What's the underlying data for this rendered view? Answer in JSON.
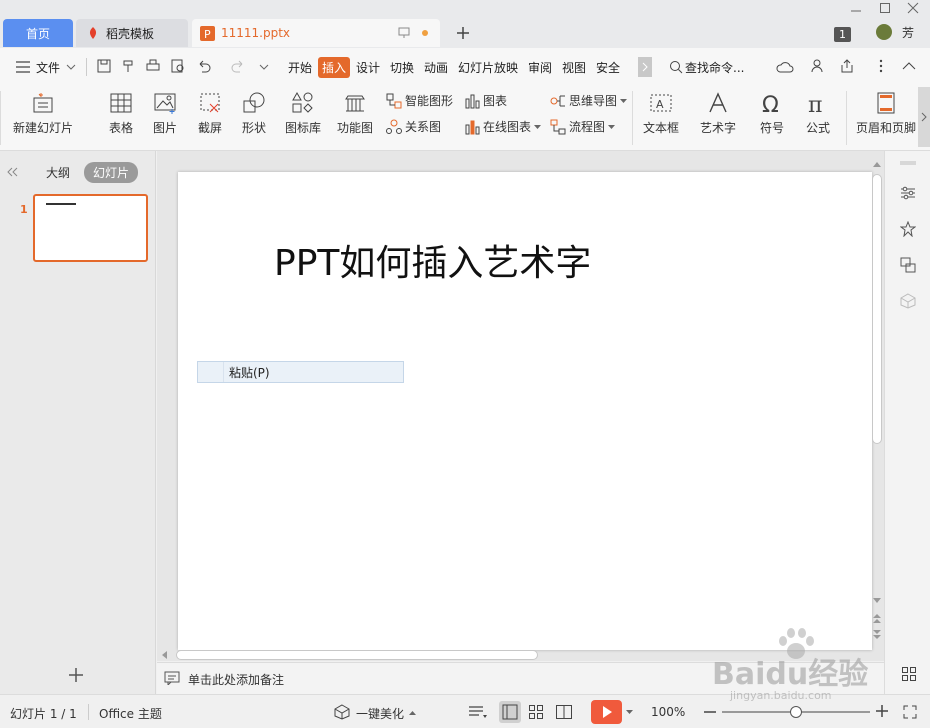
{
  "titlebar": {
    "tabs": [
      {
        "label": "首页"
      },
      {
        "label": "稻壳模板"
      },
      {
        "label": "11111.pptx"
      }
    ],
    "badge": "1",
    "user": "芳"
  },
  "menubar": {
    "file_label": "文件",
    "items": [
      "开始",
      "插入",
      "设计",
      "切换",
      "动画",
      "幻灯片放映",
      "审阅",
      "视图",
      "安全"
    ],
    "active": "插入",
    "search_placeholder": "查找命令..."
  },
  "ribbon": {
    "new_slide": "新建幻灯片",
    "table": "表格",
    "picture": "图片",
    "screenshot": "截屏",
    "shape": "形状",
    "icon_lib": "图标库",
    "function_chart": "功能图",
    "smart_art": "智能图形",
    "relation": "关系图",
    "chart": "图表",
    "online_chart": "在线图表",
    "mind_map": "思维导图",
    "flow_chart": "流程图",
    "textbox": "文本框",
    "wordart": "艺术字",
    "symbol": "符号",
    "formula": "公式",
    "header_footer": "页眉和页脚"
  },
  "leftpanel": {
    "outline_tab": "大纲",
    "slides_tab": "幻灯片",
    "slide_number": "1"
  },
  "slide": {
    "title": "PPT如何插入艺术字",
    "context_menu": {
      "paste": "粘贴(P)"
    }
  },
  "notes": {
    "placeholder": "单击此处添加备注"
  },
  "statusbar": {
    "slide_info": "幻灯片 1 / 1",
    "theme": "Office 主题",
    "beautify": "一键美化",
    "zoom": "100%"
  },
  "watermark": {
    "brand": "Baidu经验",
    "url": "jingyan.baidu.com"
  },
  "colors": {
    "accent": "#e4692b",
    "home_tab": "#5b8ff0"
  }
}
